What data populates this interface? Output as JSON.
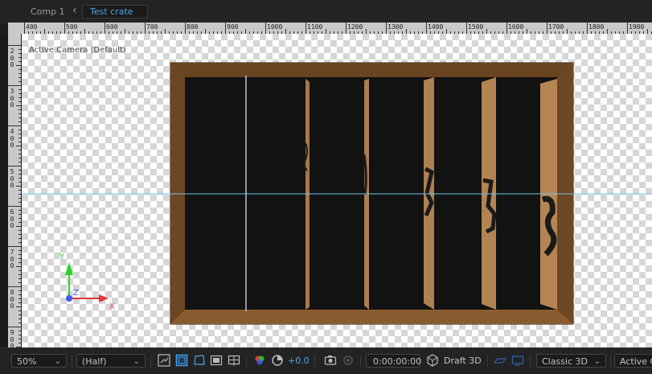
{
  "tabs": {
    "comp": "Comp 1",
    "separator": "‹",
    "active": "Test crate"
  },
  "ruler": {
    "top_labels": [
      "400",
      "500",
      "600",
      "700",
      "800",
      "900",
      "1000",
      "1100",
      "1200",
      "1300",
      "1400",
      "1500",
      "1600",
      "1700",
      "1800",
      "1900"
    ],
    "left_labels": [
      "200",
      "300",
      "400",
      "500",
      "600",
      "700",
      "800",
      "900"
    ]
  },
  "viewer": {
    "camera_label": "Active Camera (Default)",
    "axes": {
      "y": "Y",
      "z": "Z",
      "x": "X"
    }
  },
  "toolbar": {
    "zoom": "50%",
    "resolution": "(Half)",
    "exposure": "+0.0",
    "timecode": "0:00:00:00",
    "draft": "Draft 3D",
    "renderer": "Classic 3D",
    "view": "Active C"
  },
  "icons": [
    "magnify-icon",
    "safe-zones-icon",
    "mask-visibility-icon",
    "region-of-interest-icon",
    "transparency-grid-icon",
    "channel-icon",
    "exposure-reset-icon",
    "snapshot-icon",
    "show-snapshot-icon",
    "draft-3d-icon",
    "3d-ground-plane-icon",
    "extended-viewer-icon"
  ]
}
